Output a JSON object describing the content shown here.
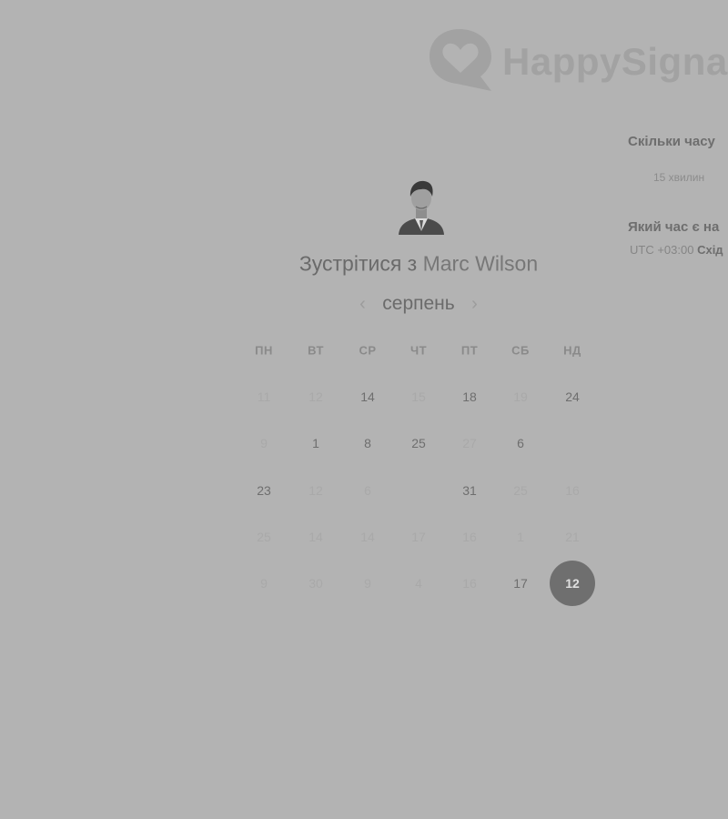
{
  "brand": {
    "name": "HappySigna"
  },
  "host": {
    "prefix": "Зустрітися з",
    "name": "Marc Wilson"
  },
  "calendar": {
    "month": "серпень",
    "prev_icon": "chevron-left-icon",
    "next_icon": "chevron-right-icon",
    "weekdays": [
      "ПН",
      "ВТ",
      "СР",
      "ЧТ",
      "ПТ",
      "СБ",
      "НД"
    ],
    "weeks": [
      [
        {
          "d": "11",
          "a": false
        },
        {
          "d": "12",
          "a": false
        },
        {
          "d": "14",
          "a": true
        },
        {
          "d": "15",
          "a": false
        },
        {
          "d": "18",
          "a": true
        },
        {
          "d": "19",
          "a": false
        },
        {
          "d": "24",
          "a": true
        }
      ],
      [
        {
          "d": "9",
          "a": false
        },
        {
          "d": "1",
          "a": true
        },
        {
          "d": "8",
          "a": true
        },
        {
          "d": "25",
          "a": true
        },
        {
          "d": "27",
          "a": false
        },
        {
          "d": "6",
          "a": true
        },
        {
          "d": "",
          "a": false
        }
      ],
      [
        {
          "d": "23",
          "a": true
        },
        {
          "d": "12",
          "a": false
        },
        {
          "d": "6",
          "a": false
        },
        {
          "d": "",
          "a": false
        },
        {
          "d": "31",
          "a": true
        },
        {
          "d": "25",
          "a": false
        },
        {
          "d": "16",
          "a": false
        }
      ],
      [
        {
          "d": "25",
          "a": false
        },
        {
          "d": "14",
          "a": false
        },
        {
          "d": "14",
          "a": false
        },
        {
          "d": "17",
          "a": false
        },
        {
          "d": "16",
          "a": false
        },
        {
          "d": "1",
          "a": false
        },
        {
          "d": "21",
          "a": false
        }
      ],
      [
        {
          "d": "9",
          "a": false
        },
        {
          "d": "30",
          "a": false
        },
        {
          "d": "9",
          "a": false
        },
        {
          "d": "4",
          "a": false
        },
        {
          "d": "16",
          "a": false
        },
        {
          "d": "17",
          "a": true
        },
        {
          "d": "12",
          "a": true,
          "selected": true
        }
      ]
    ]
  },
  "sidebar": {
    "duration_question": "Скільки часу",
    "duration_value": "15 хвилин",
    "time_question": "Який час є на",
    "tz_offset": "UTC +03:00",
    "tz_name": "Схід"
  }
}
